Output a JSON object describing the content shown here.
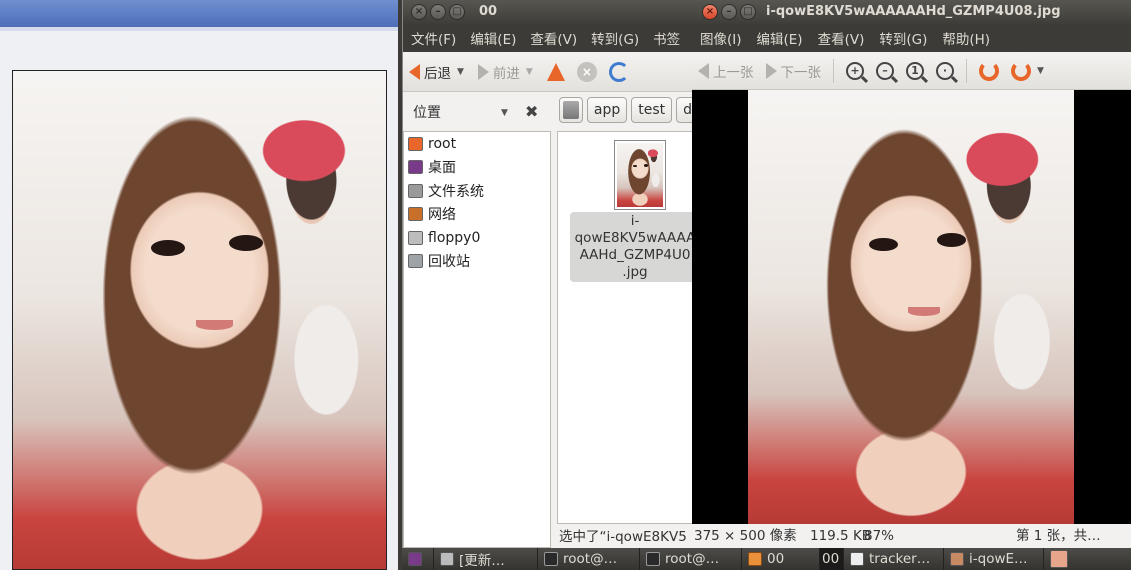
{
  "file_manager": {
    "title": "00",
    "menu": [
      "文件(F)",
      "编辑(E)",
      "查看(V)",
      "转到(G)",
      "书签"
    ],
    "toolbar": {
      "back": "后退",
      "forward": "前进"
    },
    "sidebar": {
      "header": "位置",
      "places": [
        {
          "label": "root",
          "icon": "home-icon",
          "color": "#e8662a"
        },
        {
          "label": "桌面",
          "icon": "desktop-icon",
          "color": "#7a3a8a"
        },
        {
          "label": "文件系统",
          "icon": "harddisk-icon",
          "color": "#9a9a9a"
        },
        {
          "label": "网络",
          "icon": "network-icon",
          "color": "#c8702a"
        },
        {
          "label": "floppy0",
          "icon": "floppy-icon",
          "color": "#bdbdbd"
        },
        {
          "label": "回收站",
          "icon": "trash-icon",
          "color": "#9ea3a8"
        }
      ]
    },
    "path": [
      "app",
      "test",
      "d"
    ],
    "file": {
      "name": "i-qowE8KV5wAAAAAAHd_GZMP4U08.jpg",
      "name_display": "i-\nqowE8KV5wAAAA\nAAHd_GZMP4U0\n.jpg"
    },
    "status": "选中了“i-qowE8KV5"
  },
  "image_viewer": {
    "title": "i-qowE8KV5wAAAAAAHd_GZMP4U08.jpg",
    "menu": [
      "图像(I)",
      "编辑(E)",
      "查看(V)",
      "转到(G)",
      "帮助(H)"
    ],
    "toolbar": {
      "prev": "上一张",
      "next": "下一张"
    },
    "status": {
      "dimensions": "375 × 500 像素",
      "size": "119.5 KB",
      "zoom": "87%",
      "position": "第 1 张，共…"
    }
  },
  "taskbar": {
    "items": [
      {
        "label": "",
        "icon": "desktop-icon"
      },
      {
        "label": "[更新…",
        "icon": "updater-icon"
      },
      {
        "label": "root@…",
        "icon": "terminal-icon"
      },
      {
        "label": "root@…",
        "icon": "terminal-icon"
      },
      {
        "label": "00",
        "icon": "folder-icon"
      },
      {
        "label": "00",
        "icon": "workspace-icon"
      },
      {
        "label": "tracker…",
        "icon": "text-editor-icon"
      },
      {
        "label": "i-qowE…",
        "icon": "image-viewer-icon"
      }
    ]
  }
}
